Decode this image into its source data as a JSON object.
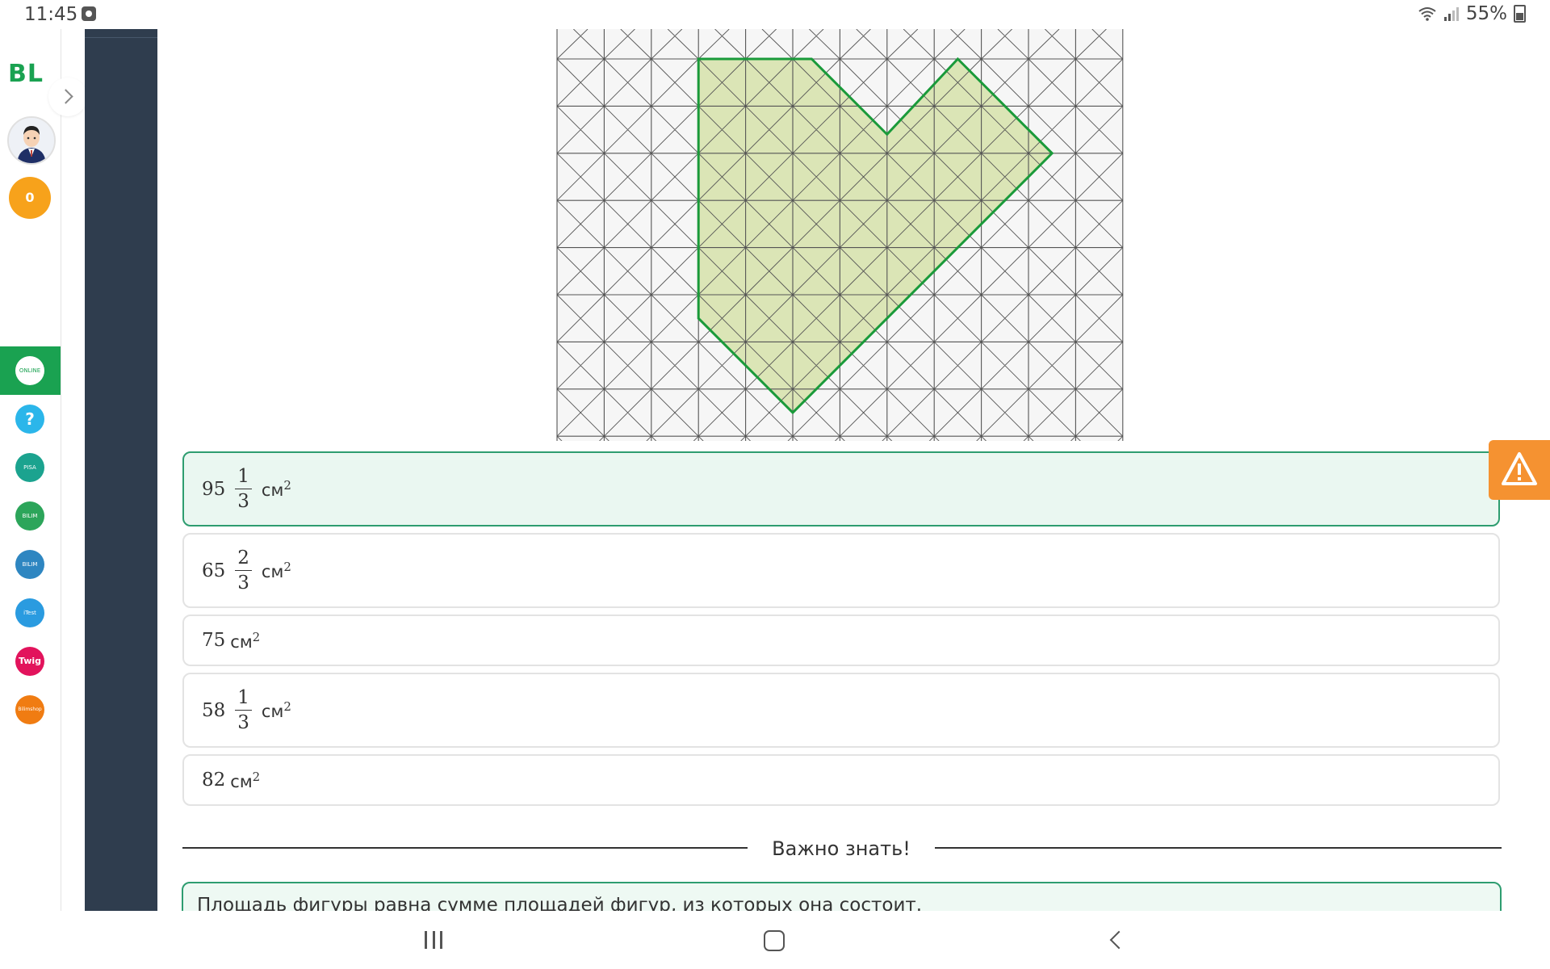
{
  "status_bar": {
    "time": "11:45",
    "battery": "55%"
  },
  "sidebar": {
    "logo": "BL",
    "coins": "0",
    "items": [
      {
        "name": "online-mektep",
        "label": "ONLINE MEKTEP",
        "color": "#1aa251"
      },
      {
        "name": "help",
        "label": "?",
        "color": "#2bb6ea"
      },
      {
        "name": "pisa",
        "label": "PISA",
        "color": "#1ba38f"
      },
      {
        "name": "bilim-land",
        "label": "BILIM Land",
        "color": "#2ca55a"
      },
      {
        "name": "bilim-book",
        "label": "BILIM Book",
        "color": "#2e86c1"
      },
      {
        "name": "itest",
        "label": "iTest",
        "color": "#2a9be0"
      },
      {
        "name": "twig",
        "label": "Twig",
        "color": "#e2135c"
      },
      {
        "name": "bilimshop",
        "label": "Bilimshop",
        "color": "#f07c12"
      }
    ]
  },
  "answers": [
    {
      "integer": "95",
      "numerator": "1",
      "denominator": "3",
      "unit": "см",
      "power": "2",
      "selected": true
    },
    {
      "integer": "65",
      "numerator": "2",
      "denominator": "3",
      "unit": "см",
      "power": "2",
      "selected": false
    },
    {
      "integer": "75",
      "numerator": "",
      "denominator": "",
      "unit": "см",
      "power": "2",
      "selected": false
    },
    {
      "integer": "58",
      "numerator": "1",
      "denominator": "3",
      "unit": "см",
      "power": "2",
      "selected": false
    },
    {
      "integer": "82",
      "numerator": "",
      "denominator": "",
      "unit": "см",
      "power": "2",
      "selected": false
    }
  ],
  "important": {
    "title": "Важно знать!",
    "text": "Площадь фигуры равна сумме площадей фигур, из которых она состоит."
  },
  "figure": {
    "grid": {
      "cols": 12,
      "rows": 9,
      "top_partial_row": true,
      "diagonals": true
    },
    "shape_vertices": [
      [
        3,
        0
      ],
      [
        5.4,
        0
      ],
      [
        7,
        1.6
      ],
      [
        8.5,
        0
      ],
      [
        10.5,
        2
      ],
      [
        5,
        7.5
      ],
      [
        3,
        5.5
      ]
    ],
    "fill_color": "#dbe5b6",
    "stroke_color": "#1a9a3a"
  },
  "colors": {
    "accent": "#1aa251",
    "selected_border": "#2e9d70",
    "warning": "#f59231",
    "dark_panel": "#2f3d4e"
  }
}
